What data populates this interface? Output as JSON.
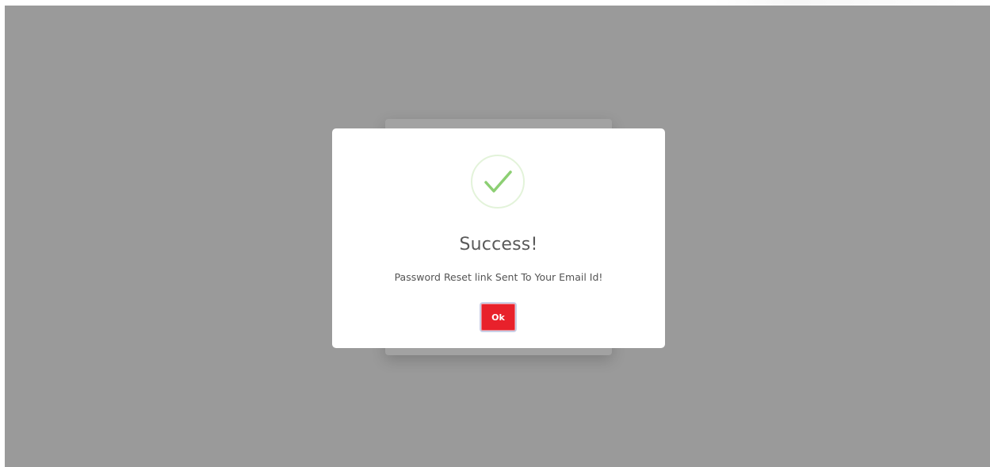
{
  "colors": {
    "backdrop": "#9a9a9a",
    "modal_background": "#ffffff",
    "success_green": "#8ccf73",
    "success_ring": "#e3f3da",
    "ok_button": "#e8212b",
    "title_text": "#595959",
    "message_text": "#545454"
  },
  "modal": {
    "icon": "check-circle-icon",
    "title": "Success!",
    "message": "Password Reset link Sent To Your Email Id!",
    "ok_label": "Ok"
  }
}
